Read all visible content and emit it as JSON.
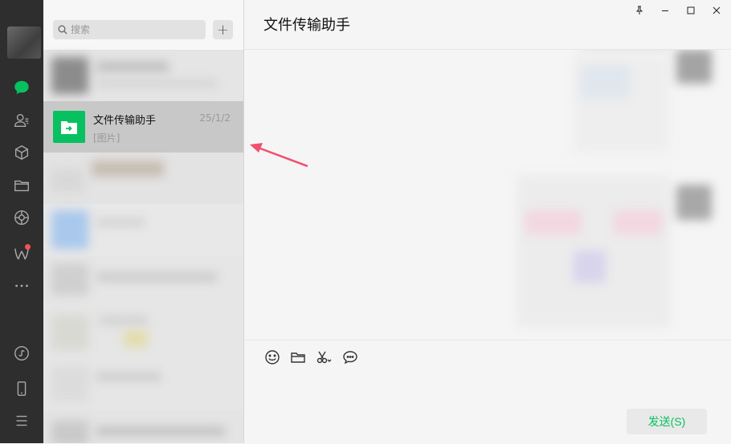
{
  "sidebar": {
    "icons": [
      "chat-icon",
      "contacts-icon",
      "favorites-icon",
      "files-icon",
      "moments-icon",
      "weixin-icon",
      "more-icon",
      "mini-program-icon",
      "phone-icon",
      "menu-icon"
    ],
    "accent": "#07c160"
  },
  "search": {
    "placeholder": "搜索",
    "add_label": "+"
  },
  "chat_list": {
    "file_helper": {
      "name": "文件传输助手",
      "date": "25/1/2",
      "preview": "[图片]"
    }
  },
  "main": {
    "title": "文件传输助手",
    "send_label": "发送(S)"
  },
  "colors": {
    "sidebar_bg": "#2e2e2e",
    "selected_bg": "#c9c8c8",
    "brand_green": "#07c160",
    "arrow": "#f0506e"
  }
}
